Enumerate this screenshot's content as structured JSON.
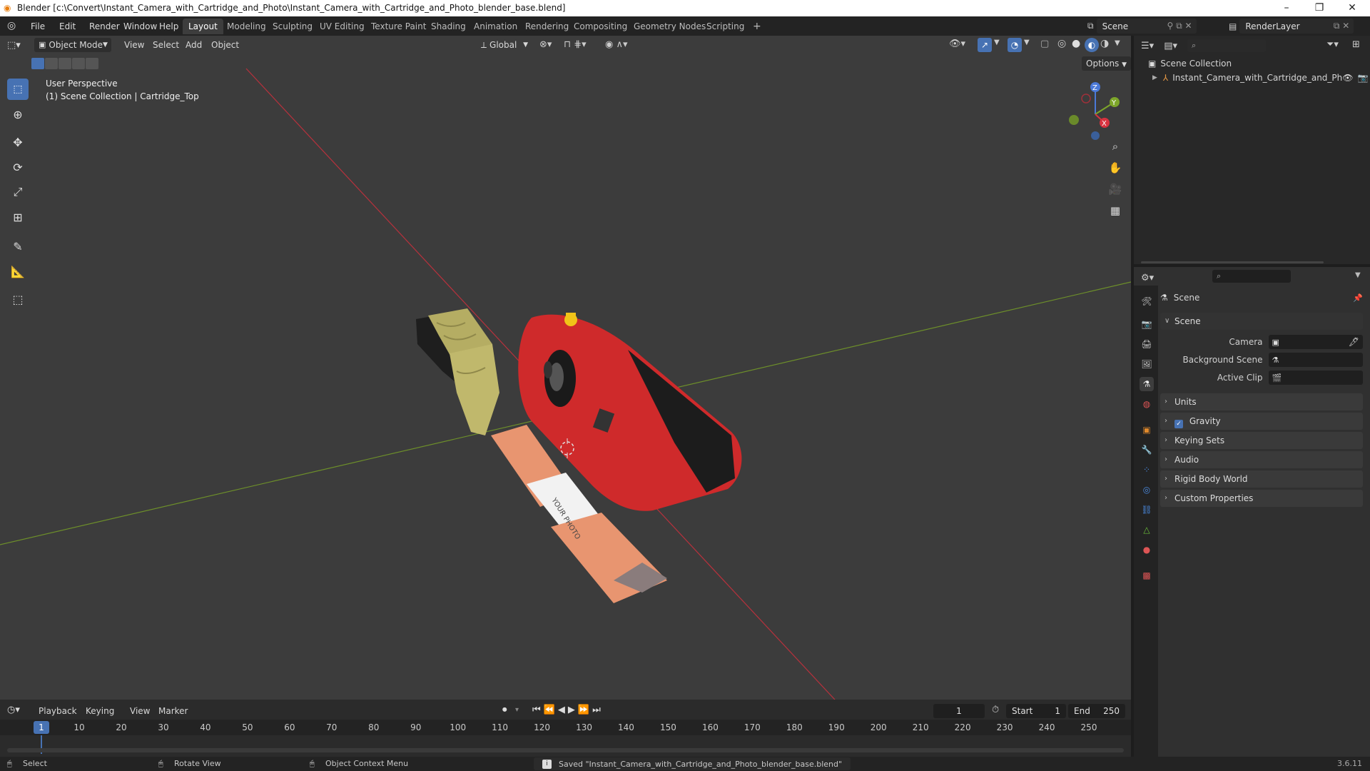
{
  "window": {
    "title": "Blender [c:\\Convert\\Instant_Camera_with_Cartridge_and_Photo\\Instant_Camera_with_Cartridge_and_Photo_blender_base.blend]"
  },
  "menus": [
    "File",
    "Edit",
    "Render",
    "Window",
    "Help"
  ],
  "workspaces": [
    "Layout",
    "Modeling",
    "Sculpting",
    "UV Editing",
    "Texture Paint",
    "Shading",
    "Animation",
    "Rendering",
    "Compositing",
    "Geometry Nodes",
    "Scripting"
  ],
  "workspace_add": "+",
  "scene_selector": {
    "value": "Scene"
  },
  "view_layer": {
    "value": "RenderLayer"
  },
  "viewport": {
    "mode": "Object Mode",
    "menus": [
      "View",
      "Select",
      "Add",
      "Object"
    ],
    "orientation": "Global",
    "options_label": "Options",
    "overlay_line1": "User Perspective",
    "overlay_line2": "(1) Scene Collection | Cartridge_Top",
    "photo_text": "YOUR PHOTO",
    "gizmo": {
      "z": "Z",
      "y": "Y",
      "x": "X"
    }
  },
  "outliner": {
    "root": "Scene Collection",
    "items": [
      {
        "label": "Instant_Camera_with_Cartridge_and_Ph"
      }
    ]
  },
  "properties": {
    "context_title": "Scene",
    "section_scene": "Scene",
    "rows": [
      {
        "label": "Camera"
      },
      {
        "label": "Background Scene"
      },
      {
        "label": "Active Clip"
      }
    ],
    "panels": [
      "Units",
      "Gravity",
      "Keying Sets",
      "Audio",
      "Rigid Body World",
      "Custom Properties"
    ],
    "gravity_checked": true
  },
  "timeline": {
    "menus": [
      "Playback",
      "Keying",
      "View",
      "Marker"
    ],
    "current_frame": "1",
    "start_label": "Start",
    "start_value": "1",
    "end_label": "End",
    "end_value": "250",
    "ticks": [
      "1",
      "10",
      "20",
      "30",
      "40",
      "50",
      "60",
      "70",
      "80",
      "90",
      "100",
      "110",
      "120",
      "130",
      "140",
      "150",
      "160",
      "170",
      "180",
      "190",
      "200",
      "210",
      "220",
      "230",
      "240",
      "250"
    ]
  },
  "statusbar": {
    "select": "Select",
    "rotate": "Rotate View",
    "context_menu": "Object Context Menu",
    "message": "Saved \"Instant_Camera_with_Cartridge_and_Photo_blender_base.blend\"",
    "version": "3.6.11"
  },
  "colors": {
    "accent": "#4772b3",
    "x_axis": "#c0303c",
    "y_axis": "#6a8f2a",
    "camera_red": "#d0282a"
  }
}
